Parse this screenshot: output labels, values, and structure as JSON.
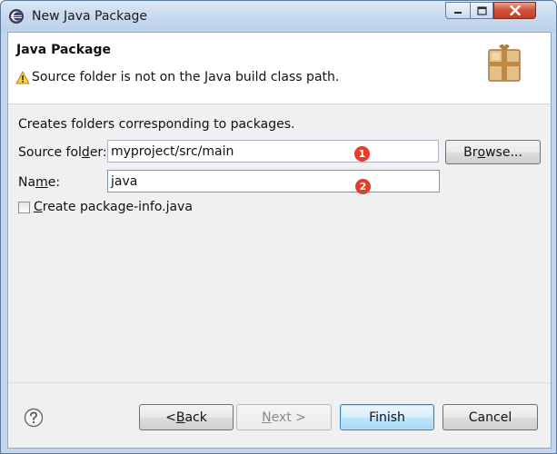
{
  "window": {
    "title": "New Java Package",
    "controls": [
      "minimize",
      "maximize",
      "close"
    ]
  },
  "header": {
    "title": "Java Package",
    "message": "Source folder is not on the Java build class path.",
    "message_icon": "warning-icon",
    "banner_icon": "package-icon"
  },
  "form": {
    "description": "Creates folders corresponding to packages.",
    "source_folder": {
      "label_pre": "Source fol",
      "label_mnemonic": "d",
      "label_post": "er:",
      "value": "myproject/src/main",
      "badge": "1"
    },
    "browse_button": {
      "pre": "Br",
      "mnemonic": "o",
      "post": "wse..."
    },
    "name": {
      "label_pre": "Na",
      "label_mnemonic": "m",
      "label_post": "e:",
      "value": "java",
      "badge": "2"
    },
    "create_package_info": {
      "checked": false,
      "mnemonic": "C",
      "label_post": "reate package-info.java"
    }
  },
  "footer": {
    "help_icon": "help-icon",
    "back": {
      "pre": "< ",
      "mnemonic": "B",
      "post": "ack"
    },
    "next": {
      "pre": "",
      "mnemonic": "N",
      "post": "ext >",
      "enabled": false
    },
    "finish": "Finish",
    "cancel": "Cancel"
  },
  "colors": {
    "title_bar": "#c6d9ee",
    "close_button": "#c23e26",
    "badge": "#e63b2a",
    "default_button_border": "#3c7fb1"
  }
}
